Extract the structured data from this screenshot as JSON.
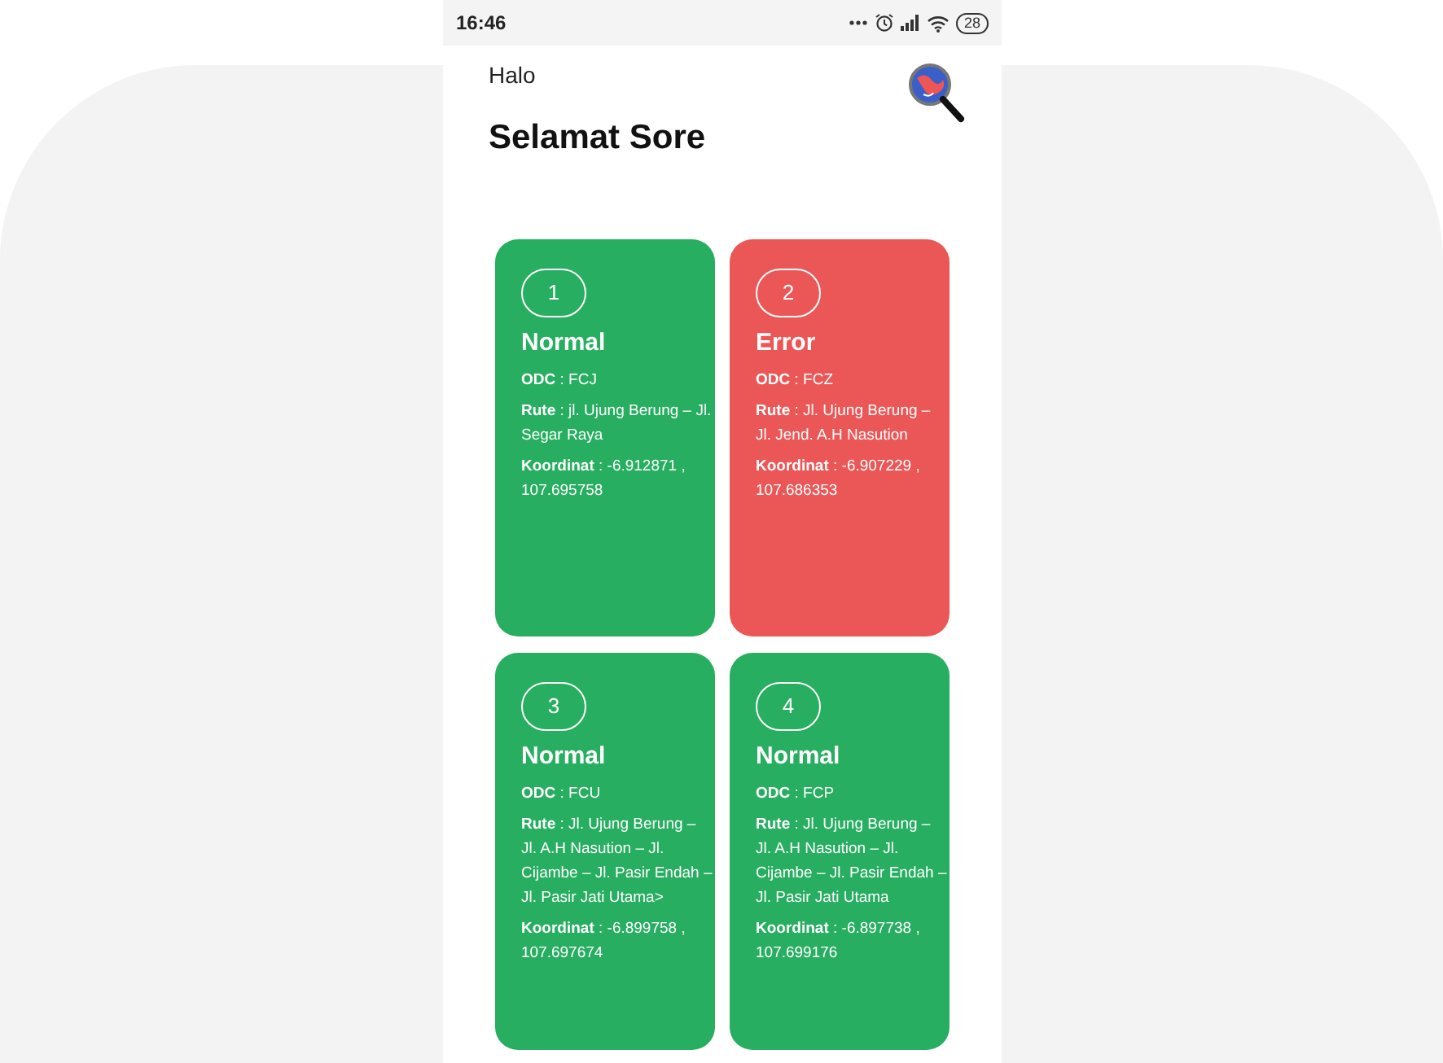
{
  "status_bar": {
    "time": "16:46",
    "battery": "28"
  },
  "header": {
    "greeting": "Halo",
    "title": "Selamat Sore"
  },
  "cards": [
    {
      "number": "1",
      "status": "Normal",
      "color": "#27ae60",
      "odc": "**ODC** : FCJ",
      "route": "**Rute** : jl. Ujung Berung – Jl. Segar Raya",
      "coordinates": "**Koordinat** : -6.912871 , 107.695758"
    },
    {
      "number": "2",
      "status": "Error",
      "color": "#eb5757",
      "odc": "**ODC** : FCZ",
      "route": "**Rute** : Jl. Ujung Berung – Jl. Jend. A.H Nasution",
      "coordinates": "**Koordinat** : -6.907229 , 107.686353"
    },
    {
      "number": "3",
      "status": "Normal",
      "color": "#27ae60",
      "odc": "**ODC** : FCU",
      "route": "**Rute** : Jl. Ujung Berung – Jl. A.H Nasution – Jl. Cijambe – Jl. Pasir Endah – Jl. Pasir Jati Utama>",
      "coordinates": "**Koordinat** : -6.899758 , 107.697674"
    },
    {
      "number": "4",
      "status": "Normal",
      "color": "#27ae60",
      "odc": "**ODC** : FCP",
      "route": "**Rute** : Jl. Ujung Berung – Jl. A.H Nasution – Jl. Cijambe – Jl. Pasir Endah – Jl. Pasir Jati Utama",
      "coordinates": "**Koordinat** : -6.897738 , 107.699176"
    }
  ]
}
